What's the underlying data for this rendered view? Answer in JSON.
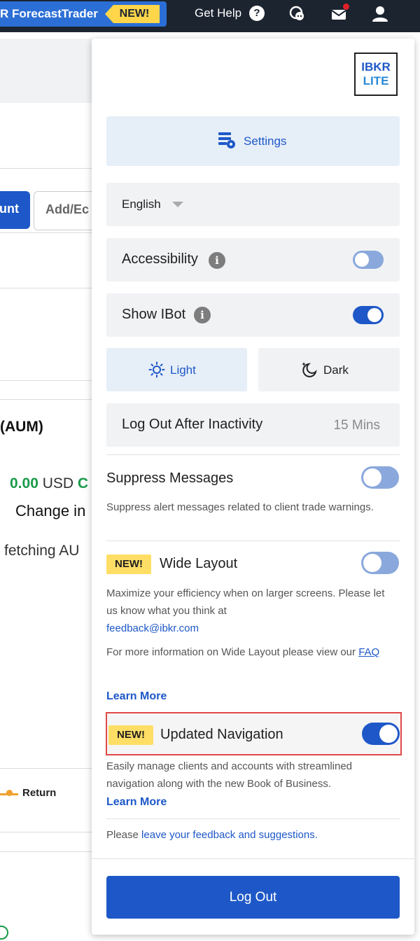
{
  "topbar": {
    "forecast_label": "R ForecastTrader",
    "new_badge": "NEW!",
    "get_help": "Get Help",
    "help_symbol": "?"
  },
  "background": {
    "account_btn": "unt",
    "add_btn": "Add/Ec",
    "aum_heading": "(AUM)",
    "usd_value": "0.00",
    "usd_unit": "USD",
    "usd_tail": "C",
    "change_label": "Change in",
    "fetching_text": "fetching AU",
    "legend_return": "Return"
  },
  "panel": {
    "logo_line1": "IBKR",
    "logo_line2": "LITE",
    "settings_label": "Settings",
    "language": {
      "selected": "English"
    },
    "accessibility": {
      "label": "Accessibility",
      "info": "i",
      "enabled": false
    },
    "show_ibot": {
      "label": "Show IBot",
      "info": "i",
      "enabled": true
    },
    "theme": {
      "light_label": "Light",
      "dark_label": "Dark",
      "selected": "light"
    },
    "logout_after": {
      "label": "Log Out After Inactivity",
      "value": "15 Mins"
    },
    "suppress": {
      "title": "Suppress Messages",
      "description": "Suppress alert messages related to client trade warnings.",
      "enabled": false
    },
    "wide_layout": {
      "badge": "NEW!",
      "title": "Wide Layout",
      "desc_line": "Maximize your efficiency when on larger screens. Please let us know what you think at",
      "email": "feedback@ibkr.com",
      "more_info": "For more information on Wide Layout please view our",
      "faq": "FAQ",
      "learn_more": "Learn More",
      "enabled": false
    },
    "updated_nav": {
      "badge": "NEW!",
      "title": "Updated Navigation",
      "description": "Easily manage clients and accounts with streamlined navigation along with the new Book of Business.",
      "learn_more": "Learn More",
      "enabled": true
    },
    "feedback": {
      "prefix": "Please",
      "link": "leave your feedback and suggestions."
    },
    "logout_button": "Log Out"
  },
  "colors": {
    "accent": "#1e58c8",
    "new_badge": "#ffde65",
    "topbar": "#1c2430",
    "highlight_border": "#e04848"
  }
}
